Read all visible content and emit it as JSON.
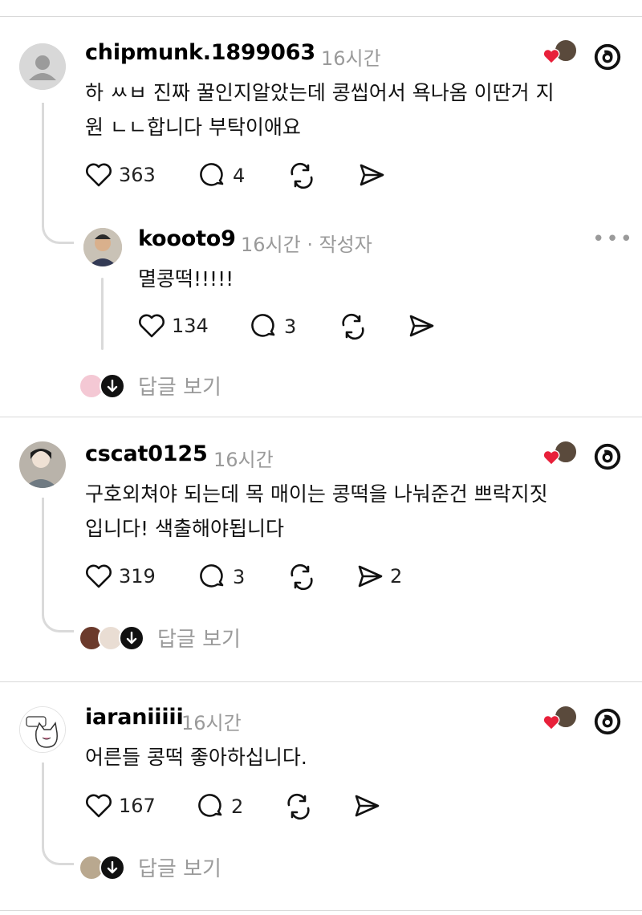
{
  "posts": [
    {
      "username": "chipmunk.1899063",
      "time": "16시간",
      "text_line1": "하 ㅆㅂ 진짜 꿀인지알았는데 콩씹어서 욕나옴 이딴거 지",
      "text_line2": "원 ㄴㄴ합니다 부탁이애요",
      "likes": "363",
      "comments": "4",
      "shares": "",
      "reply": {
        "username": "koooto9",
        "time": "16시간 · 작성자",
        "text": "멸콩떡!!!!!",
        "likes": "134",
        "comments": "3",
        "more": "•••"
      },
      "view_replies": "답글 보기"
    },
    {
      "username": "cscat0125",
      "time": "16시간",
      "text_line1": "구호외쳐야 되는데 목 매이는 콩떡을 나눠준건 쁘락지짓",
      "text_line2": "입니다! 색출해야됩니다",
      "likes": "319",
      "comments": "3",
      "shares": "2",
      "view_replies": "답글 보기"
    },
    {
      "username": "iaraniiiii",
      "time": "16시간",
      "text_line1": "어른들 콩떡 좋아하십니다.",
      "likes": "167",
      "comments": "2",
      "view_replies": "답글 보기"
    }
  ],
  "colors": {
    "like_heart": "#e8203a",
    "muted_text": "#9a9a9a",
    "divider": "#d9d9d9"
  },
  "icons": [
    "heart-icon",
    "comment-icon",
    "repost-icon",
    "share-icon",
    "threads-logo-icon",
    "arrow-down-icon"
  ]
}
